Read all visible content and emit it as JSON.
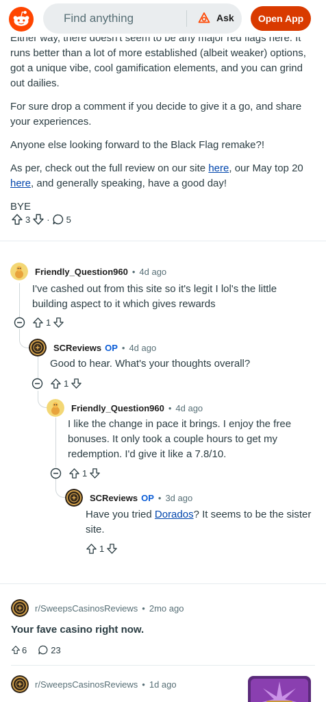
{
  "header": {
    "search_placeholder": "Find anything",
    "ask_label": "Ask",
    "open_app_label": "Open App"
  },
  "post": {
    "paragraphs": {
      "p0": "Either way, there doesn't seem to be any major red flags here. It runs better than a lot of more established (albeit weaker) options, got a unique vibe, cool gamification elements, and you can grind out dailies.",
      "p1": "For sure drop a comment if you decide to give it a go, and share your experiences.",
      "p2": "Anyone else looking forward to the Black Flag remake?!",
      "p3_a": "As per, check out the full review on our site ",
      "p3_link1": "here",
      "p3_b": ", our May top 20 ",
      "p3_link2": "here",
      "p3_c": ", and generally speaking, have a good day!",
      "p4": "BYE"
    },
    "upvotes": "3",
    "separator": "·",
    "comments": "5"
  },
  "comments": [
    {
      "author": "Friendly_Question960",
      "op": "",
      "dot": "•",
      "time": "4d ago",
      "text": "I've cashed out from this site so it's legit I lol's the little building aspect to it which gives rewards",
      "votes": "1"
    },
    {
      "author": "SCReviews",
      "op": "OP",
      "dot": "•",
      "time": "4d ago",
      "text": "Good to hear. What's your thoughts overall?",
      "votes": "1"
    },
    {
      "author": "Friendly_Question960",
      "op": "",
      "dot": "•",
      "time": "4d ago",
      "text": "I like the change in pace it brings. I enjoy the free bonuses. It only took a couple hours to get my redemption. I'd give it like a 7.8/10.",
      "votes": "1"
    },
    {
      "author": "SCReviews",
      "op": "OP",
      "dot": "•",
      "time": "3d ago",
      "text_a": "Have you tried ",
      "text_link": "Dorados",
      "text_b": "? It seems to be the sister site.",
      "votes": "1"
    }
  ],
  "feed": [
    {
      "subreddit": "r/SweepsCasinosReviews",
      "dot": "•",
      "time": "2mo ago",
      "title": "Your fave casino right now.",
      "upvotes": "6",
      "comments": "23"
    },
    {
      "subreddit": "r/SweepsCasinosReviews",
      "dot": "•",
      "time": "1d ago"
    }
  ],
  "colors": {
    "brand": "#ff4500",
    "open_app": "#d93a00",
    "op_label": "#0a5cd6",
    "link": "#0045ac"
  }
}
